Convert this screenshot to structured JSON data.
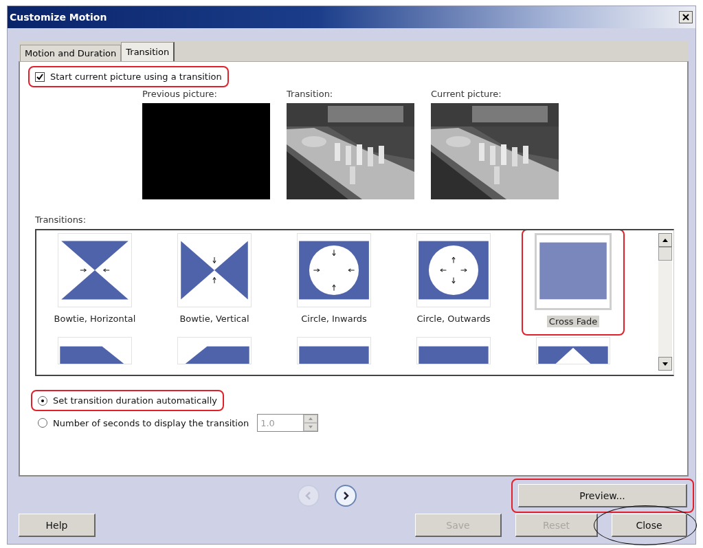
{
  "window": {
    "title": "Customize Motion"
  },
  "tabs": [
    {
      "label": "Motion and Duration",
      "selected": false
    },
    {
      "label": "Transition",
      "selected": true
    }
  ],
  "start_checkbox": {
    "label": "Start current picture using a transition",
    "checked": true,
    "highlighted": true
  },
  "previews": [
    {
      "label": "Previous picture:",
      "kind": "blank"
    },
    {
      "label": "Transition:",
      "kind": "picture"
    },
    {
      "label": "Current picture:",
      "kind": "picture"
    }
  ],
  "transitions": {
    "label": "Transitions:",
    "items": [
      {
        "label": "Bowtie, Horizontal",
        "kind": "bowtie-h",
        "selected": false,
        "highlighted": false
      },
      {
        "label": "Bowtie, Vertical",
        "kind": "bowtie-v",
        "selected": false,
        "highlighted": false
      },
      {
        "label": "Circle, Inwards",
        "kind": "circle-in",
        "selected": false,
        "highlighted": false
      },
      {
        "label": "Circle, Outwards",
        "kind": "circle-out",
        "selected": false,
        "highlighted": false
      },
      {
        "label": "Cross Fade",
        "kind": "fade",
        "selected": true,
        "highlighted": true
      },
      {
        "kind": "diag-left",
        "selected": false,
        "highlighted": false
      },
      {
        "kind": "diag-right",
        "selected": false,
        "highlighted": false
      },
      {
        "kind": "bar",
        "selected": false,
        "highlighted": false
      },
      {
        "kind": "bar",
        "selected": false,
        "highlighted": false
      },
      {
        "kind": "diamond",
        "selected": false,
        "highlighted": false
      }
    ]
  },
  "duration_options": [
    {
      "label": "Set transition duration automatically",
      "selected": true,
      "highlighted": true
    },
    {
      "label": "Number of seconds to display the transition",
      "selected": false,
      "highlighted": false,
      "field": {
        "value": "1.0",
        "disabled": true
      }
    }
  ],
  "nav": [
    {
      "kind": "back",
      "disabled": true
    },
    {
      "kind": "forward",
      "disabled": false
    }
  ],
  "preview_button": {
    "label": "Preview...",
    "highlighted": true
  },
  "buttons": [
    {
      "label": "Help",
      "disabled": false,
      "circled": false
    },
    {
      "label": "Save",
      "disabled": true,
      "circled": false
    },
    {
      "label": "Reset",
      "disabled": true,
      "circled": false
    },
    {
      "label": "Close",
      "disabled": false,
      "circled": true
    }
  ]
}
